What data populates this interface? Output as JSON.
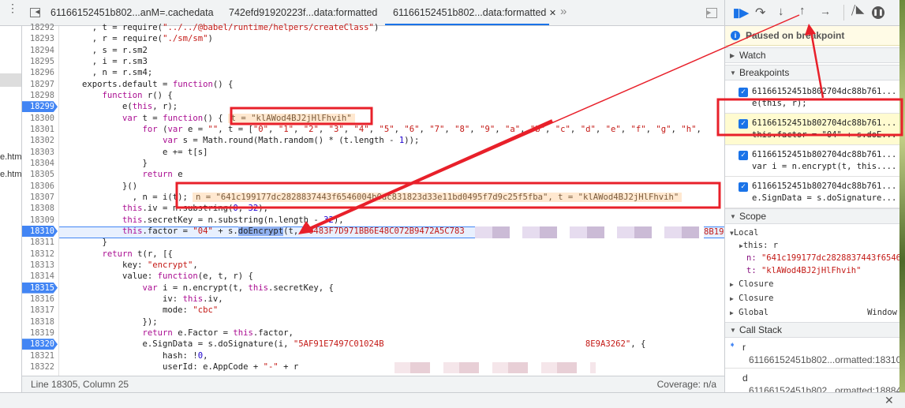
{
  "tabs": [
    {
      "label": "61166152451b802...anM=.cachedata"
    },
    {
      "label": "742efd91920223f...data:formatted"
    },
    {
      "label": "61166152451b802...data:formatted",
      "active": true
    }
  ],
  "tab_close": "✕",
  "tab_more": "»",
  "left_nav": {
    "items": [
      "e.htm",
      "e.htm"
    ]
  },
  "editor": {
    "lines": [
      {
        "num": "18292",
        "seg": [
          [
            "p",
            "  , t = require("
          ],
          [
            "s",
            "\"../../@babel/runtime/helpers/createClass\""
          ],
          [
            "p",
            ")"
          ]
        ]
      },
      {
        "num": "18293",
        "seg": [
          [
            "p",
            "  , r = require("
          ],
          [
            "s",
            "\"./sm/sm\""
          ],
          [
            "p",
            ")"
          ]
        ]
      },
      {
        "num": "18294",
        "seg": [
          [
            "p",
            "  , s = r.sm2"
          ]
        ]
      },
      {
        "num": "18295",
        "seg": [
          [
            "p",
            "  , i = r.sm3"
          ]
        ]
      },
      {
        "num": "18296",
        "seg": [
          [
            "p",
            "  , n = r.sm4;"
          ]
        ]
      },
      {
        "num": "18297",
        "seg": [
          [
            "p",
            "exports.default = "
          ],
          [
            "k",
            "function"
          ],
          [
            "p",
            "() {"
          ]
        ]
      },
      {
        "num": "18298",
        "seg": [
          [
            "p",
            "    "
          ],
          [
            "k",
            "function"
          ],
          [
            "p",
            " r() {"
          ]
        ]
      },
      {
        "num": "18299",
        "bp": true,
        "seg": [
          [
            "p",
            "        e("
          ],
          [
            "k",
            "this"
          ],
          [
            "p",
            ", r);"
          ]
        ]
      },
      {
        "num": "18300",
        "seg": [
          [
            "p",
            "        "
          ],
          [
            "k",
            "var"
          ],
          [
            "p",
            " t = "
          ],
          [
            "k",
            "function"
          ],
          [
            "p",
            "() {"
          ]
        ],
        "inline": "t = \"klAWod4BJ2jHlFhvih\""
      },
      {
        "num": "18301",
        "seg": [
          [
            "p",
            "            "
          ],
          [
            "k",
            "for"
          ],
          [
            "p",
            " ("
          ],
          [
            "k",
            "var"
          ],
          [
            "p",
            " e = "
          ],
          [
            "s",
            "\"\""
          ],
          [
            "p",
            ", t = ["
          ],
          [
            "s",
            "\"0\""
          ],
          [
            "p",
            ", "
          ],
          [
            "s",
            "\"1\""
          ],
          [
            "p",
            ", "
          ],
          [
            "s",
            "\"2\""
          ],
          [
            "p",
            ", "
          ],
          [
            "s",
            "\"3\""
          ],
          [
            "p",
            ", "
          ],
          [
            "s",
            "\"4\""
          ],
          [
            "p",
            ", "
          ],
          [
            "s",
            "\"5\""
          ],
          [
            "p",
            ", "
          ],
          [
            "s",
            "\"6\""
          ],
          [
            "p",
            ", "
          ],
          [
            "s",
            "\"7\""
          ],
          [
            "p",
            ", "
          ],
          [
            "s",
            "\"8\""
          ],
          [
            "p",
            ", "
          ],
          [
            "s",
            "\"9\""
          ],
          [
            "p",
            ", "
          ],
          [
            "s",
            "\"a\""
          ],
          [
            "p",
            ", "
          ],
          [
            "s",
            "\"b\""
          ],
          [
            "p",
            ", "
          ],
          [
            "s",
            "\"c\""
          ],
          [
            "p",
            ", "
          ],
          [
            "s",
            "\"d\""
          ],
          [
            "p",
            ", "
          ],
          [
            "s",
            "\"e\""
          ],
          [
            "p",
            ", "
          ],
          [
            "s",
            "\"f\""
          ],
          [
            "p",
            ", "
          ],
          [
            "s",
            "\"g\""
          ],
          [
            "p",
            ", "
          ],
          [
            "s",
            "\"h\""
          ],
          [
            "p",
            ","
          ]
        ]
      },
      {
        "num": "18302",
        "seg": [
          [
            "p",
            "                "
          ],
          [
            "k",
            "var"
          ],
          [
            "p",
            " s = Math.round(Math.random() * (t.length - "
          ],
          [
            "n",
            "1"
          ],
          [
            "p",
            "));"
          ]
        ]
      },
      {
        "num": "18303",
        "seg": [
          [
            "p",
            "                e += t[s]"
          ]
        ]
      },
      {
        "num": "18304",
        "seg": [
          [
            "p",
            "            }"
          ]
        ]
      },
      {
        "num": "18305",
        "seg": [
          [
            "p",
            "            "
          ],
          [
            "k",
            "return"
          ],
          [
            "p",
            " e"
          ]
        ]
      },
      {
        "num": "18306",
        "seg": [
          [
            "p",
            "        }()"
          ]
        ]
      },
      {
        "num": "18307",
        "seg": [
          [
            "p",
            "          , n = i(t);"
          ]
        ],
        "inline": "n = \"641c199177dc2828837443f6546004b0dc831823d33e11bd0495f7d9c25f5fba\", t = \"klAWod4BJ2jHlFhvih\""
      },
      {
        "num": "18308",
        "seg": [
          [
            "p",
            "        "
          ],
          [
            "k",
            "this"
          ],
          [
            "p",
            ".iv = n.substring("
          ],
          [
            "n",
            "0"
          ],
          [
            "p",
            ", "
          ],
          [
            "n",
            "32"
          ],
          [
            "p",
            "),"
          ]
        ]
      },
      {
        "num": "18309",
        "seg": [
          [
            "p",
            "        "
          ],
          [
            "k",
            "this"
          ],
          [
            "p",
            ".secretKey = n.substring(n.length - "
          ],
          [
            "n",
            "32"
          ],
          [
            "p",
            "),"
          ]
        ]
      },
      {
        "num": "18310",
        "bp": true,
        "exec": true,
        "seg": [
          [
            "p",
            "        "
          ],
          [
            "k",
            "this"
          ],
          [
            "p",
            ".factor = "
          ],
          [
            "s",
            "\"04\""
          ],
          [
            "p",
            " + s."
          ],
          [
            "h",
            "doEncrypt"
          ],
          [
            "p",
            "(t, "
          ],
          [
            "s",
            "\"0483F7D971BB6E48C072B9472A5C783"
          ]
        ]
      },
      {
        "num": "18311",
        "seg": [
          [
            "p",
            "    }"
          ]
        ]
      },
      {
        "num": "18312",
        "seg": [
          [
            "p",
            "    "
          ],
          [
            "k",
            "return"
          ],
          [
            "p",
            " t(r, [{"
          ]
        ]
      },
      {
        "num": "18313",
        "seg": [
          [
            "p",
            "        key: "
          ],
          [
            "s",
            "\"encrypt\""
          ],
          [
            "p",
            ","
          ]
        ]
      },
      {
        "num": "18314",
        "seg": [
          [
            "p",
            "        value: "
          ],
          [
            "k",
            "function"
          ],
          [
            "p",
            "(e, t, r) {"
          ]
        ]
      },
      {
        "num": "18315",
        "bp": true,
        "seg": [
          [
            "p",
            "            "
          ],
          [
            "k",
            "var"
          ],
          [
            "p",
            " i = n.encrypt(t, "
          ],
          [
            "k",
            "this"
          ],
          [
            "p",
            ".secretKey, {"
          ]
        ]
      },
      {
        "num": "18316",
        "seg": [
          [
            "p",
            "                iv: "
          ],
          [
            "k",
            "this"
          ],
          [
            "p",
            ".iv,"
          ]
        ]
      },
      {
        "num": "18317",
        "seg": [
          [
            "p",
            "                mode: "
          ],
          [
            "s",
            "\"cbc\""
          ]
        ]
      },
      {
        "num": "18318",
        "seg": [
          [
            "p",
            "            });"
          ]
        ]
      },
      {
        "num": "18319",
        "seg": [
          [
            "p",
            "            "
          ],
          [
            "k",
            "return"
          ],
          [
            "p",
            " e.Factor = "
          ],
          [
            "k",
            "this"
          ],
          [
            "p",
            ".factor,"
          ]
        ]
      },
      {
        "num": "18320",
        "bp": true,
        "seg": [
          [
            "p",
            "            e.SignData = s.doSignature(i, "
          ],
          [
            "s",
            "\"5AF91E7497C01024B"
          ],
          [
            "p",
            "                                        "
          ],
          [
            "s",
            "8E9A3262\""
          ],
          [
            "p",
            ", {"
          ]
        ]
      },
      {
        "num": "18321",
        "seg": [
          [
            "p",
            "                hash: !"
          ],
          [
            "n",
            "0"
          ],
          [
            "p",
            ","
          ]
        ]
      },
      {
        "num": "18322",
        "seg": [
          [
            "p",
            "                userId: e.AppCode + "
          ],
          [
            "s",
            "\"-\""
          ],
          [
            "p",
            " + r"
          ]
        ]
      }
    ],
    "line18310_tail": "8B19"
  },
  "status": {
    "position": "Line 18305, Column 25",
    "coverage": "Coverage: n/a"
  },
  "debugger": {
    "toolbar": [
      "resume-icon",
      "step-over-icon",
      "step-into-icon",
      "step-out-icon",
      "step-icon",
      "deactivate-breakpoints-icon",
      "pause-on-exceptions-icon"
    ],
    "paused_message": "Paused on breakpoint",
    "watch_label": "Watch",
    "breakpoints_label": "Breakpoints",
    "breakpoints": [
      {
        "file": "61166152451b802704dc88b761...",
        "code": "e(this, r);",
        "checked": true
      },
      {
        "file": "61166152451b802704dc88b761...",
        "code": "this.factor = \"04\" + s.doE...",
        "checked": true,
        "active": true
      },
      {
        "file": "61166152451b802704dc88b761...",
        "code": "var i = n.encrypt(t, this....",
        "checked": true
      },
      {
        "file": "61166152451b802704dc88b761...",
        "code": "e.SignData = s.doSignature...",
        "checked": true
      }
    ],
    "scope_label": "Scope",
    "local_label": "Local",
    "scope_vars": [
      {
        "name": "this",
        "value": "r"
      },
      {
        "name": "n",
        "value": "\"641c199177dc2828837443f6546004b0dc831823d33e11bd0495f7d9c25f5fba\""
      },
      {
        "name": "t",
        "value": "\"klAWod4BJ2jHlFhvih\""
      }
    ],
    "closures": [
      "Closure",
      "Closure"
    ],
    "global_label": "Global",
    "global_value": "Window",
    "callstack_label": "Call Stack",
    "callstack": [
      {
        "fn": "r",
        "loc": "61166152451b802...ormatted:18310"
      },
      {
        "fn": "d",
        "loc": "61166152451b802...ormatted:18884"
      }
    ]
  },
  "colors": {
    "accent": "#1a73e8",
    "annotation": "#e8202a",
    "paused_bg": "#fffbe6"
  }
}
